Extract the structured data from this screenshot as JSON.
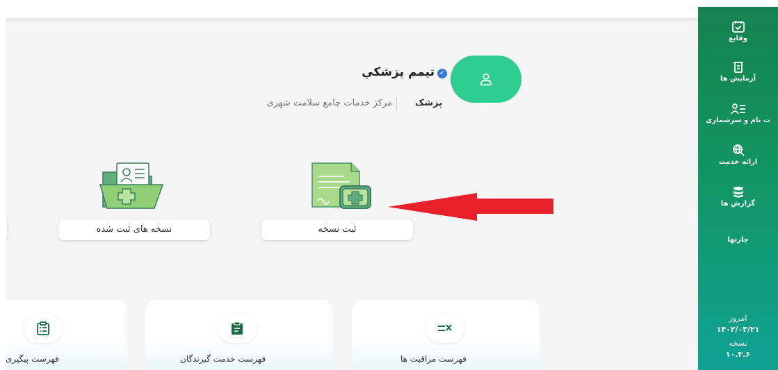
{
  "profile": {
    "name": "تیمم پزشکي",
    "role": "پزشک",
    "center": "مرکز خدمات جامع سلامت شهری"
  },
  "actions": [
    {
      "label": "ثبت نسخه"
    },
    {
      "label": "نسخه های ثبت شده"
    }
  ],
  "cards": [
    {
      "label": "فهرست مراقبت ها",
      "icon": "checklist-icon"
    },
    {
      "label": "فهرست خدمت گیرندگان",
      "icon": "clipboard-icon"
    },
    {
      "label": "فهرست پیگیری",
      "icon": "clipboard-list-icon"
    }
  ],
  "sidebar": {
    "items": [
      {
        "label": "وقایع",
        "icon": "calendar-check-icon"
      },
      {
        "label": "آزمایش ها",
        "icon": "test-tube-icon"
      },
      {
        "label": "ت نام و سرشماری",
        "icon": "user-list-icon"
      },
      {
        "label": "ارائه خدمت",
        "icon": "search-globe-icon"
      },
      {
        "label": "گزارش ها",
        "icon": "database-icon"
      },
      {
        "label": "چارتها",
        "icon": ""
      }
    ],
    "footer": {
      "today_label": "امروز",
      "today_value": "۱۴۰۲/۰۳/۲۱",
      "version_label": "نسخه",
      "version_value": "۱۰.۳.۶"
    }
  },
  "colors": {
    "sidebar": "#12935e",
    "avatar": "#2ecc8f",
    "arrow": "#e8202a",
    "background": "#f5f5f5"
  }
}
